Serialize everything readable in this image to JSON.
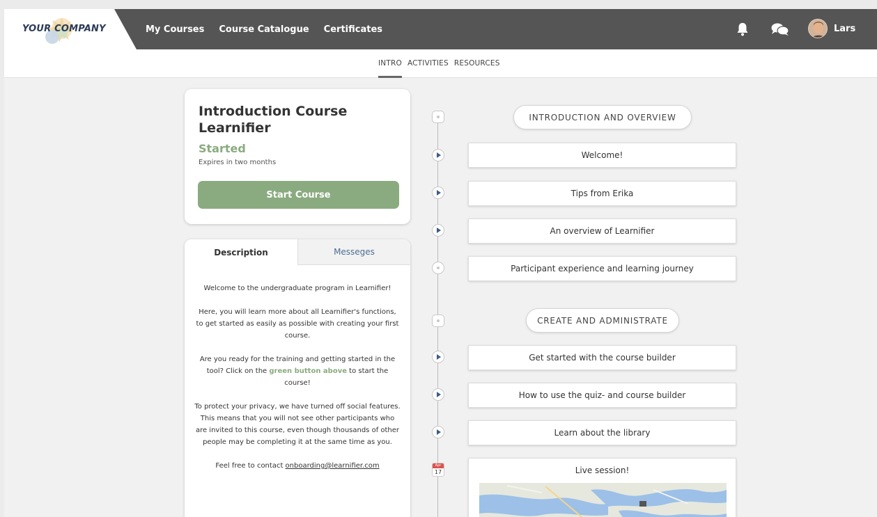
{
  "brand": {
    "name": "YOUR COMPANY"
  },
  "nav": {
    "items": [
      "My Courses",
      "Course Catalogue",
      "Certificates"
    ]
  },
  "user": {
    "name": "Lars"
  },
  "subtabs": [
    "INTRO",
    "ACTIVITIES",
    "RESOURCES"
  ],
  "course": {
    "title": "Introduction Course Learnifier",
    "status": "Started",
    "expires": "Expires in two months",
    "start_label": "Start Course"
  },
  "panel": {
    "tab_description": "Description",
    "tab_messages": "Messeges",
    "p1": "Welcome to the undergraduate program in Learnifier!",
    "p2": "Here, you will learn more about all Learnifier's functions, to get started as easily as possible with creating your first course.",
    "p3_a": "Are you ready for the training and getting started in the tool? Click on the ",
    "p3_link": "green button above",
    "p3_b": " to start the course!",
    "p4": "To protect your privacy, we have turned off social features. This means that you will not see other participants who are invited to this course, even though thousands of other people may be completing it at the same time as you.",
    "p5_a": "Feel free to contact ",
    "p5_email": "onboarding@learnifier.com"
  },
  "timeline": {
    "section1": "INTRODUCTION AND OVERVIEW",
    "section1_items": [
      "Welcome!",
      "Tips from Erika",
      "An overview of Learnifier",
      "Participant experience and learning journey"
    ],
    "section2": "CREATE AND ADMINISTRATE",
    "section2_items": [
      "Get started with the course builder",
      "How to use the quiz- and course builder",
      "Learn about the library"
    ],
    "live_title": "Live session!",
    "live_month": "Apr",
    "live_day": "17"
  },
  "colors": {
    "accent_green": "#8aab7f",
    "topbar": "#555555",
    "link_blue": "#4b6c93"
  }
}
